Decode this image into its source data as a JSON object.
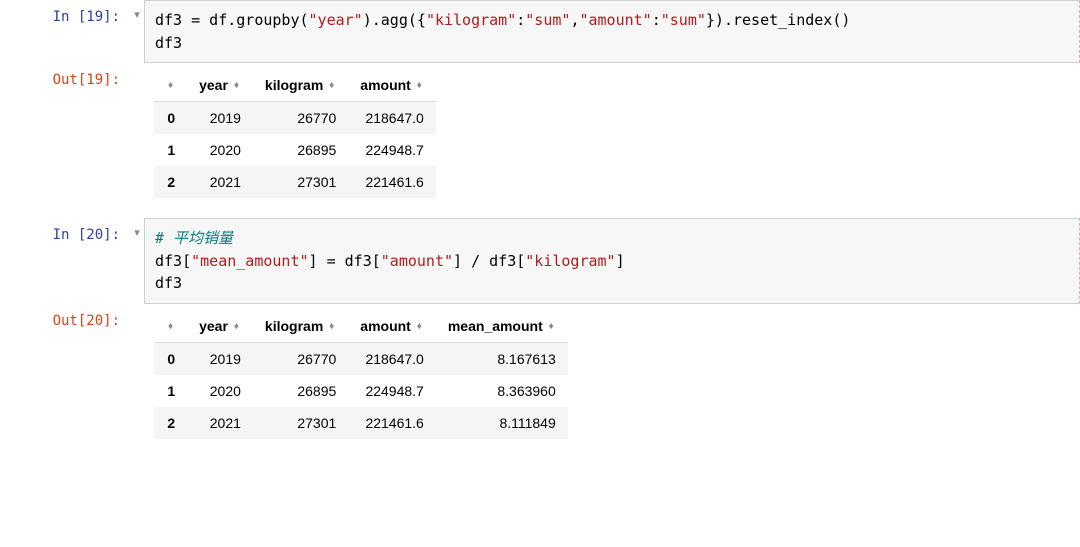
{
  "cells": {
    "c19": {
      "in_prompt": "In [19]:",
      "out_prompt": "Out[19]:",
      "run_glyph": "▾",
      "code": {
        "line1_pre": "df3 = df.groupby(",
        "line1_str1": "\"year\"",
        "line1_mid1": ").agg({",
        "line1_str2": "\"kilogram\"",
        "line1_mid2": ":",
        "line1_str3": "\"sum\"",
        "line1_mid3": ",",
        "line1_str4": "\"amount\"",
        "line1_mid4": ":",
        "line1_str5": "\"sum\"",
        "line1_post": "}).reset_index()",
        "line2": "df3"
      },
      "table": {
        "headers": {
          "h0": "",
          "h1": "year",
          "h2": "kilogram",
          "h3": "amount"
        },
        "rows": [
          {
            "idx": "0",
            "year": "2019",
            "kilogram": "26770",
            "amount": "218647.0"
          },
          {
            "idx": "1",
            "year": "2020",
            "kilogram": "26895",
            "amount": "224948.7"
          },
          {
            "idx": "2",
            "year": "2021",
            "kilogram": "27301",
            "amount": "221461.6"
          }
        ]
      }
    },
    "c20": {
      "in_prompt": "In [20]:",
      "out_prompt": "Out[20]:",
      "run_glyph": "▾",
      "code": {
        "comment": "# 平均销量",
        "line2_pre": "df3[",
        "line2_str1": "\"mean_amount\"",
        "line2_mid1": "] = df3[",
        "line2_str2": "\"amount\"",
        "line2_mid2": "] / df3[",
        "line2_str3": "\"kilogram\"",
        "line2_post": "]",
        "line3": "df3"
      },
      "table": {
        "headers": {
          "h0": "",
          "h1": "year",
          "h2": "kilogram",
          "h3": "amount",
          "h4": "mean_amount"
        },
        "rows": [
          {
            "idx": "0",
            "year": "2019",
            "kilogram": "26770",
            "amount": "218647.0",
            "mean_amount": "8.167613"
          },
          {
            "idx": "1",
            "year": "2020",
            "kilogram": "26895",
            "amount": "224948.7",
            "mean_amount": "8.363960"
          },
          {
            "idx": "2",
            "year": "2021",
            "kilogram": "27301",
            "amount": "221461.6",
            "mean_amount": "8.111849"
          }
        ]
      }
    }
  },
  "sort_glyph": "♦"
}
